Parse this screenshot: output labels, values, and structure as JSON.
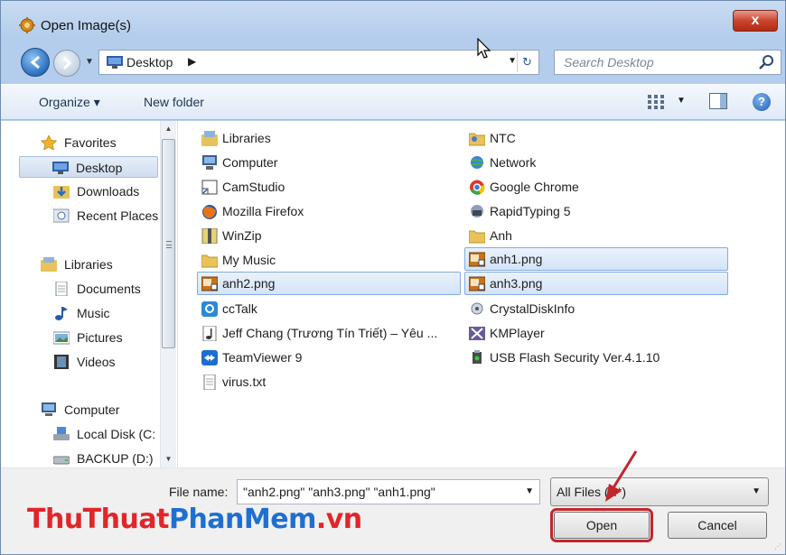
{
  "window": {
    "title": "Open Image(s)",
    "close_label": "x"
  },
  "address": {
    "location": "Desktop",
    "search_placeholder": "Search Desktop"
  },
  "toolbar": {
    "organize": "Organize ▾",
    "new_folder": "New folder"
  },
  "nav_pane": {
    "items": [
      {
        "label": "Favorites",
        "icon": "star-icon",
        "group": true
      },
      {
        "label": "Desktop",
        "icon": "desktop-icon",
        "selected": true
      },
      {
        "label": "Downloads",
        "icon": "downloads-folder-icon"
      },
      {
        "label": "Recent Places",
        "icon": "recent-places-icon"
      },
      {
        "label": "Libraries",
        "icon": "libraries-icon",
        "group": true
      },
      {
        "label": "Documents",
        "icon": "document-icon"
      },
      {
        "label": "Music",
        "icon": "music-icon"
      },
      {
        "label": "Pictures",
        "icon": "pictures-icon"
      },
      {
        "label": "Videos",
        "icon": "videos-icon"
      },
      {
        "label": "Computer",
        "icon": "computer-icon",
        "group": true
      },
      {
        "label": "Local Disk (C:",
        "icon": "local-disk-icon"
      },
      {
        "label": "BACKUP (D:)",
        "icon": "drive-icon"
      }
    ]
  },
  "files": {
    "col1": [
      {
        "label": "Libraries",
        "icon": "libraries-icon"
      },
      {
        "label": "Computer",
        "icon": "computer-icon"
      },
      {
        "label": "CamStudio",
        "icon": "shortcut-icon"
      },
      {
        "label": "Mozilla Firefox",
        "icon": "firefox-icon"
      },
      {
        "label": "WinZip",
        "icon": "winzip-icon"
      },
      {
        "label": "My Music",
        "icon": "folder-icon"
      },
      {
        "label": "anh2.png",
        "icon": "image-file-icon",
        "selected": true
      },
      {
        "label": "ccTalk",
        "icon": "cctalk-icon"
      },
      {
        "label": "Jeff Chang (Trương Tín Triết) – Yêu ...",
        "icon": "audio-file-icon"
      },
      {
        "label": "TeamViewer 9",
        "icon": "teamviewer-icon"
      },
      {
        "label": "virus.txt",
        "icon": "text-file-icon"
      }
    ],
    "col2": [
      {
        "label": "NTC",
        "icon": "user-folder-icon"
      },
      {
        "label": "Network",
        "icon": "network-icon"
      },
      {
        "label": "Google Chrome",
        "icon": "chrome-icon"
      },
      {
        "label": "RapidTyping 5",
        "icon": "rapidtyping-icon"
      },
      {
        "label": "Anh",
        "icon": "folder-icon"
      },
      {
        "label": "anh1.png",
        "icon": "image-file-icon",
        "selected": true
      },
      {
        "label": "anh3.png",
        "icon": "image-file-icon",
        "selected": true
      },
      {
        "label": "CrystalDiskInfo",
        "icon": "crystaldiskinfo-icon"
      },
      {
        "label": "KMPlayer",
        "icon": "kmplayer-icon"
      },
      {
        "label": "USB Flash Security Ver.4.1.10",
        "icon": "usb-security-icon"
      }
    ]
  },
  "bottom": {
    "file_name_label": "File name:",
    "file_name_value": "\"anh2.png\" \"anh3.png\" \"anh1.png\"",
    "file_type": "All Files (*.*)",
    "open_label": "Open",
    "cancel_label": "Cancel"
  },
  "watermark": {
    "part1": "ThuThuat",
    "part2": "PhanMem",
    "part3": ".vn"
  },
  "colors": {
    "accent": "#1f6fd1",
    "highlight": "#c0272d",
    "selection": "#d3e3f7"
  }
}
